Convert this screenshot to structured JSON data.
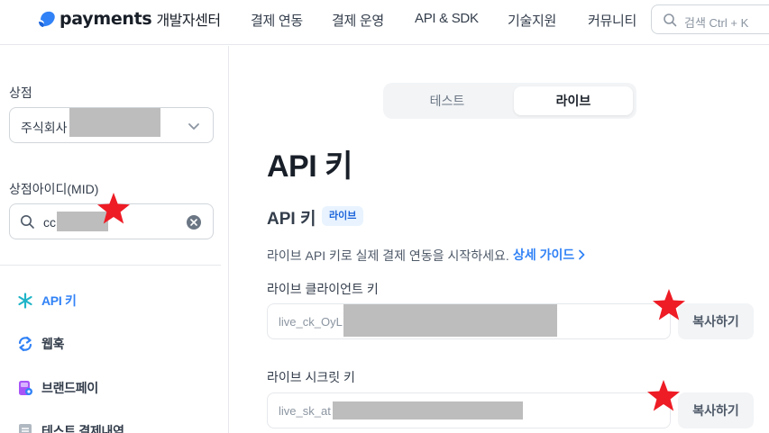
{
  "header": {
    "logo_word": "payments",
    "logo_sub": "개발자센터",
    "nav": [
      "결제 연동",
      "결제 운영",
      "API & SDK",
      "기술지원",
      "커뮤니티"
    ],
    "search_placeholder": "검색 Ctrl + K"
  },
  "sidebar": {
    "store_label": "상점",
    "store_value": "주식회사",
    "mid_label": "상점아이디(MID)",
    "mid_value": "cc",
    "menu": [
      {
        "label": "API 키",
        "icon": "asterisk-icon",
        "active": true
      },
      {
        "label": "웹훅",
        "icon": "refresh-icon",
        "active": false
      },
      {
        "label": "브랜드페이",
        "icon": "brandpay-icon",
        "active": false
      },
      {
        "label": "테스트 결제내역",
        "icon": "receipt-icon",
        "active": false
      }
    ]
  },
  "main": {
    "tabs": [
      "테스트",
      "라이브"
    ],
    "active_tab": "라이브",
    "page_title": "API 키",
    "section_title": "API 키",
    "section_badge": "라이브",
    "description": "라이브 API 키로 실제 결제 연동을 시작하세요.",
    "guide_link": "상세 가이드",
    "client_key_label": "라이브 클라이언트 키",
    "client_key_value": "live_ck_OyL",
    "secret_key_label": "라이브 시크릿 키",
    "secret_key_value": "live_sk_at",
    "copy_label": "복사하기"
  },
  "colors": {
    "accent": "#3182f6",
    "star": "#ee1c25",
    "redaction": "#bdbdbd"
  }
}
